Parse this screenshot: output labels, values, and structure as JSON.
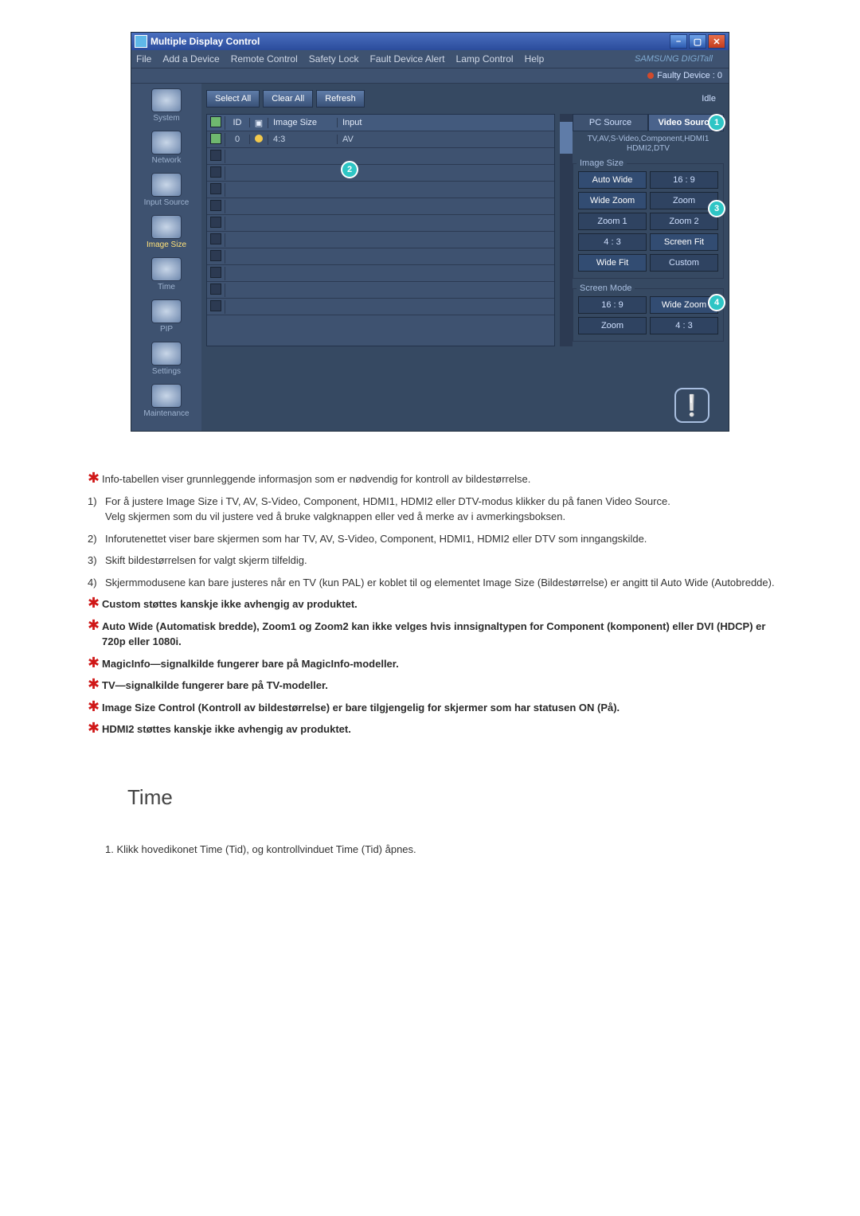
{
  "app": {
    "title": "Multiple Display Control",
    "menu": [
      "File",
      "Add a Device",
      "Remote Control",
      "Safety Lock",
      "Fault Device Alert",
      "Lamp Control",
      "Help"
    ],
    "brand": "SAMSUNG DIGITall",
    "fault_device": "Faulty Device : 0",
    "toolbar": {
      "select_all": "Select All",
      "clear_all": "Clear All",
      "refresh": "Refresh",
      "idle": "Idle"
    },
    "sidebar": [
      {
        "label": "System",
        "active": false
      },
      {
        "label": "Network",
        "active": false
      },
      {
        "label": "Input Source",
        "active": false
      },
      {
        "label": "Image Size",
        "active": true
      },
      {
        "label": "Time",
        "active": false
      },
      {
        "label": "PIP",
        "active": false
      },
      {
        "label": "Settings",
        "active": false
      },
      {
        "label": "Maintenance",
        "active": false
      }
    ],
    "table": {
      "headers": {
        "id": "ID",
        "image_size": "Image Size",
        "input": "Input"
      },
      "data_row": {
        "id": "0",
        "image_size": "4:3",
        "input": "AV"
      },
      "empty_rows": 10
    },
    "panel": {
      "tabs": {
        "pc": "PC Source",
        "video": "Video Source"
      },
      "sub_line1": "TV,AV,S-Video,Component,HDMI1",
      "sub_line2": "HDMI2,DTV",
      "legend_image_size": "Image Size",
      "image_size_buttons": [
        [
          "Auto Wide",
          "16 : 9"
        ],
        [
          "Wide Zoom",
          "Zoom"
        ],
        [
          "Zoom 1",
          "Zoom 2"
        ],
        [
          "4 : 3",
          "Screen Fit"
        ],
        [
          "Wide Fit",
          "Custom"
        ]
      ],
      "legend_screen_mode": "Screen Mode",
      "screen_mode_buttons": [
        [
          "16 : 9",
          "Wide Zoom"
        ],
        [
          "Zoom",
          "4 : 3"
        ]
      ]
    },
    "badges": {
      "b1": "1",
      "b2": "2",
      "b3": "3",
      "b4": "4"
    }
  },
  "desc": {
    "star1": "Info-tabellen viser grunnleggende informasjon som er nødvendig for kontroll av bildestørrelse.",
    "n1a": "For å justere Image Size i TV, AV, S-Video, Component, HDMI1, HDMI2 eller DTV-modus klikker du på fanen Video Source.",
    "n1b": "Velg skjermen som du vil justere ved å bruke valgknappen eller ved å merke av i avmerkingsboksen.",
    "n2": "Inforutenettet viser bare skjermen som har TV, AV, S-Video, Component, HDMI1, HDMI2 eller DTV som inngangskilde.",
    "n3": "Skift bildestørrelsen for valgt skjerm tilfeldig.",
    "n4": "Skjermmodusene kan bare justeres når en TV (kun PAL) er koblet til og elementet Image Size (Bildestørrelse) er angitt til Auto Wide (Autobredde).",
    "b1": "Custom støttes kanskje ikke avhengig av produktet.",
    "b2": "Auto Wide (Automatisk bredde), Zoom1 og Zoom2 kan ikke velges hvis innsignaltypen for Component (komponent) eller DVI (HDCP) er 720p eller 1080i.",
    "b3": "MagicInfo—signalkilde fungerer bare på MagicInfo-modeller.",
    "b4": "TV—signalkilde fungerer bare på TV-modeller.",
    "b5": "Image Size Control (Kontroll av bildestørrelse) er bare tilgjengelig for skjermer som har statusen ON (På).",
    "b6": "HDMI2 støttes kanskje ikke avhengig av produktet."
  },
  "section": {
    "title": "Time",
    "line1": "1.  Klikk hovedikonet Time (Tid), og kontrollvinduet Time (Tid) åpnes."
  }
}
